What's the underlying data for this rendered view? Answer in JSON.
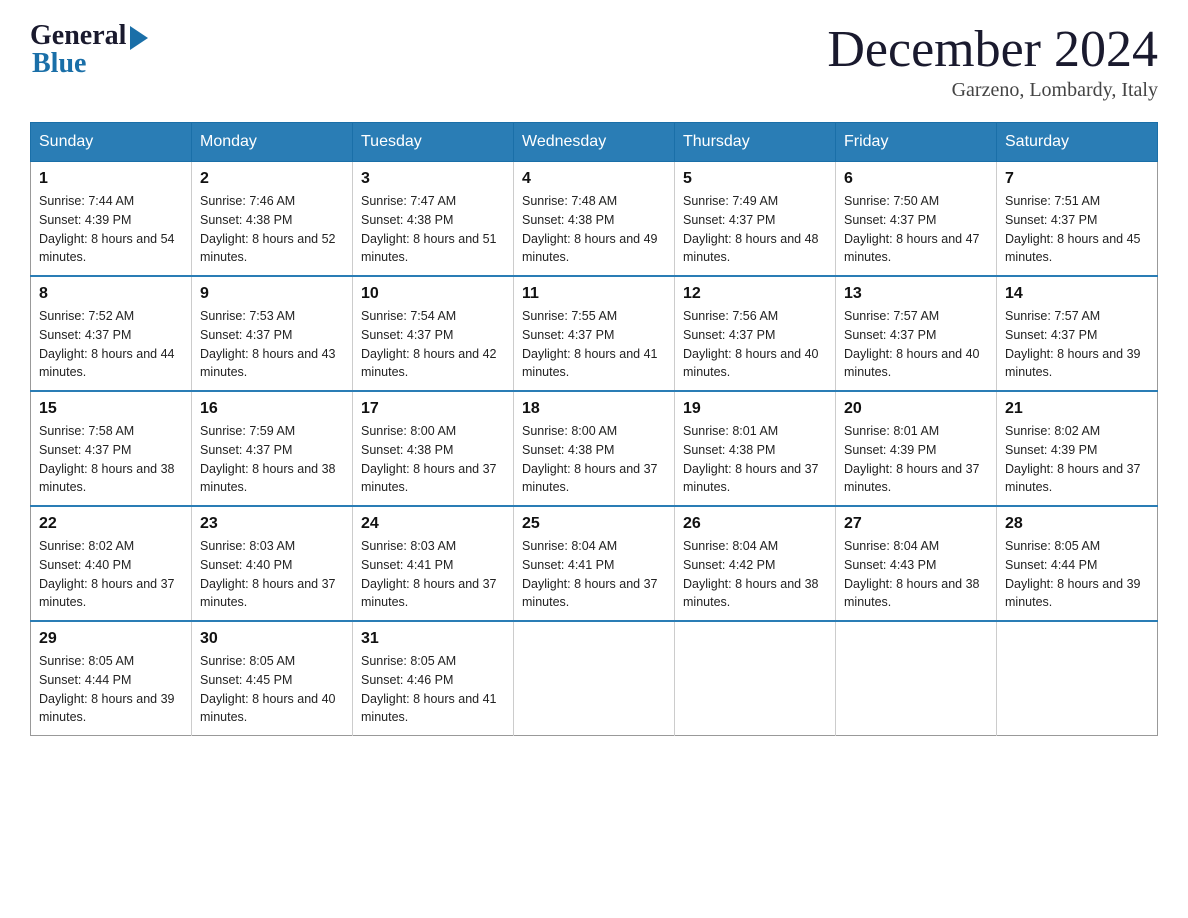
{
  "header": {
    "logo_general": "General",
    "logo_blue": "Blue",
    "month_title": "December 2024",
    "location": "Garzeno, Lombardy, Italy"
  },
  "days_of_week": [
    "Sunday",
    "Monday",
    "Tuesday",
    "Wednesday",
    "Thursday",
    "Friday",
    "Saturday"
  ],
  "weeks": [
    [
      {
        "day": "1",
        "sunrise": "7:44 AM",
        "sunset": "4:39 PM",
        "daylight": "8 hours and 54 minutes."
      },
      {
        "day": "2",
        "sunrise": "7:46 AM",
        "sunset": "4:38 PM",
        "daylight": "8 hours and 52 minutes."
      },
      {
        "day": "3",
        "sunrise": "7:47 AM",
        "sunset": "4:38 PM",
        "daylight": "8 hours and 51 minutes."
      },
      {
        "day": "4",
        "sunrise": "7:48 AM",
        "sunset": "4:38 PM",
        "daylight": "8 hours and 49 minutes."
      },
      {
        "day": "5",
        "sunrise": "7:49 AM",
        "sunset": "4:37 PM",
        "daylight": "8 hours and 48 minutes."
      },
      {
        "day": "6",
        "sunrise": "7:50 AM",
        "sunset": "4:37 PM",
        "daylight": "8 hours and 47 minutes."
      },
      {
        "day": "7",
        "sunrise": "7:51 AM",
        "sunset": "4:37 PM",
        "daylight": "8 hours and 45 minutes."
      }
    ],
    [
      {
        "day": "8",
        "sunrise": "7:52 AM",
        "sunset": "4:37 PM",
        "daylight": "8 hours and 44 minutes."
      },
      {
        "day": "9",
        "sunrise": "7:53 AM",
        "sunset": "4:37 PM",
        "daylight": "8 hours and 43 minutes."
      },
      {
        "day": "10",
        "sunrise": "7:54 AM",
        "sunset": "4:37 PM",
        "daylight": "8 hours and 42 minutes."
      },
      {
        "day": "11",
        "sunrise": "7:55 AM",
        "sunset": "4:37 PM",
        "daylight": "8 hours and 41 minutes."
      },
      {
        "day": "12",
        "sunrise": "7:56 AM",
        "sunset": "4:37 PM",
        "daylight": "8 hours and 40 minutes."
      },
      {
        "day": "13",
        "sunrise": "7:57 AM",
        "sunset": "4:37 PM",
        "daylight": "8 hours and 40 minutes."
      },
      {
        "day": "14",
        "sunrise": "7:57 AM",
        "sunset": "4:37 PM",
        "daylight": "8 hours and 39 minutes."
      }
    ],
    [
      {
        "day": "15",
        "sunrise": "7:58 AM",
        "sunset": "4:37 PM",
        "daylight": "8 hours and 38 minutes."
      },
      {
        "day": "16",
        "sunrise": "7:59 AM",
        "sunset": "4:37 PM",
        "daylight": "8 hours and 38 minutes."
      },
      {
        "day": "17",
        "sunrise": "8:00 AM",
        "sunset": "4:38 PM",
        "daylight": "8 hours and 37 minutes."
      },
      {
        "day": "18",
        "sunrise": "8:00 AM",
        "sunset": "4:38 PM",
        "daylight": "8 hours and 37 minutes."
      },
      {
        "day": "19",
        "sunrise": "8:01 AM",
        "sunset": "4:38 PM",
        "daylight": "8 hours and 37 minutes."
      },
      {
        "day": "20",
        "sunrise": "8:01 AM",
        "sunset": "4:39 PM",
        "daylight": "8 hours and 37 minutes."
      },
      {
        "day": "21",
        "sunrise": "8:02 AM",
        "sunset": "4:39 PM",
        "daylight": "8 hours and 37 minutes."
      }
    ],
    [
      {
        "day": "22",
        "sunrise": "8:02 AM",
        "sunset": "4:40 PM",
        "daylight": "8 hours and 37 minutes."
      },
      {
        "day": "23",
        "sunrise": "8:03 AM",
        "sunset": "4:40 PM",
        "daylight": "8 hours and 37 minutes."
      },
      {
        "day": "24",
        "sunrise": "8:03 AM",
        "sunset": "4:41 PM",
        "daylight": "8 hours and 37 minutes."
      },
      {
        "day": "25",
        "sunrise": "8:04 AM",
        "sunset": "4:41 PM",
        "daylight": "8 hours and 37 minutes."
      },
      {
        "day": "26",
        "sunrise": "8:04 AM",
        "sunset": "4:42 PM",
        "daylight": "8 hours and 38 minutes."
      },
      {
        "day": "27",
        "sunrise": "8:04 AM",
        "sunset": "4:43 PM",
        "daylight": "8 hours and 38 minutes."
      },
      {
        "day": "28",
        "sunrise": "8:05 AM",
        "sunset": "4:44 PM",
        "daylight": "8 hours and 39 minutes."
      }
    ],
    [
      {
        "day": "29",
        "sunrise": "8:05 AM",
        "sunset": "4:44 PM",
        "daylight": "8 hours and 39 minutes."
      },
      {
        "day": "30",
        "sunrise": "8:05 AM",
        "sunset": "4:45 PM",
        "daylight": "8 hours and 40 minutes."
      },
      {
        "day": "31",
        "sunrise": "8:05 AM",
        "sunset": "4:46 PM",
        "daylight": "8 hours and 41 minutes."
      },
      null,
      null,
      null,
      null
    ]
  ]
}
